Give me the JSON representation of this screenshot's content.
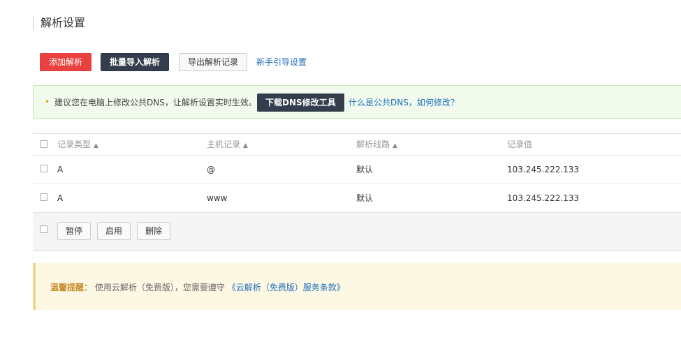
{
  "page": {
    "title": "解析设置"
  },
  "toolbar": {
    "add_label": "添加解析",
    "import_label": "批量导入解析",
    "export_label": "导出解析记录",
    "guide_link": "新手引导设置"
  },
  "tip": {
    "text": "建议您在电脑上修改公共DNS，让解析设置实时生效。",
    "download_label": "下载DNS修改工具",
    "question_link": "什么是公共DNS，如何修改？"
  },
  "table": {
    "columns": [
      "记录类型",
      "主机记录",
      "解析线路",
      "记录值"
    ],
    "rows": [
      {
        "type": "A",
        "host": "@",
        "line": "默认",
        "value": "103.245.222.133"
      },
      {
        "type": "A",
        "host": "www",
        "line": "默认",
        "value": "103.245.222.133"
      }
    ]
  },
  "bulk": {
    "pause_label": "暂停",
    "enable_label": "启用",
    "delete_label": "删除"
  },
  "notice": {
    "label": "温馨提醒：",
    "text": "使用云解析（免费版），您需要遵守",
    "link": "《云解析（免费版）服务条款》"
  },
  "colors": {
    "danger": "#e94040",
    "dark": "#333d4c",
    "link": "#1e6fbd"
  }
}
